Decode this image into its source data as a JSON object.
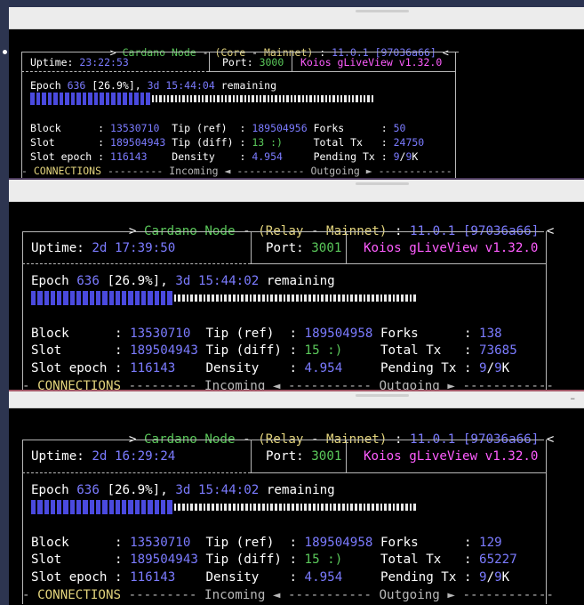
{
  "windows": [
    {
      "id": "core",
      "header": {
        "prefix": ">",
        "app": "Cardano Node",
        "dash1": "-",
        "role_open": "(Core",
        "dash2": "-",
        "network_close": "Mainnet)",
        "colon": ":",
        "version": "11.0.1",
        "commit": "[97036a66]",
        "suffix": "<"
      },
      "uptime_label": "Uptime:",
      "uptime_value": "23:22:53",
      "port_label": "Port:",
      "port_value": "3000",
      "brand": "Koios gLiveView v1.32.0",
      "epoch_label": "Epoch",
      "epoch_number": "636",
      "epoch_percent": "[26.9%],",
      "epoch_remaining": "3d 15:44:04",
      "remaining_word": "remaining",
      "progress": 0.269,
      "block_label": "Block",
      "block_value": "13530710",
      "slot_label": "Slot",
      "slot_value": "189504943",
      "slot_epoch_label": "Slot epoch",
      "slot_epoch_value": "116143",
      "tip_ref_label": "Tip (ref)",
      "tip_ref_value": "189504956",
      "tip_diff_label": "Tip (diff)",
      "tip_diff_value": "13 :)",
      "density_label": "Density",
      "density_value": "4.954",
      "forks_label": "Forks",
      "forks_value": "50",
      "total_tx_label": "Total Tx",
      "total_tx_value": "24750",
      "pending_tx_label": "Pending Tx",
      "pending_tx_a": "9",
      "pending_tx_sep": "/",
      "pending_tx_b": "9",
      "pending_tx_unit": "K",
      "connections_label": "CONNECTIONS",
      "incoming_label": "Incoming ◄",
      "outgoing_label": "Outgoing ►"
    },
    {
      "id": "relay1",
      "header": {
        "prefix": ">",
        "app": "Cardano Node",
        "dash1": "-",
        "role_open": "(Relay",
        "dash2": "-",
        "network_close": "Mainnet)",
        "colon": ":",
        "version": "11.0.1",
        "commit": "[97036a66]",
        "suffix": "<"
      },
      "uptime_label": "Uptime:",
      "uptime_value": "2d 17:39:50",
      "port_label": "Port:",
      "port_value": "3001",
      "brand": "Koios gLiveView v1.32.0",
      "epoch_label": "Epoch",
      "epoch_number": "636",
      "epoch_percent": "[26.9%],",
      "epoch_remaining": "3d 15:44:02",
      "remaining_word": "remaining",
      "progress": 0.269,
      "block_label": "Block",
      "block_value": "13530710",
      "slot_label": "Slot",
      "slot_value": "189504943",
      "slot_epoch_label": "Slot epoch",
      "slot_epoch_value": "116143",
      "tip_ref_label": "Tip (ref)",
      "tip_ref_value": "189504958",
      "tip_diff_label": "Tip (diff)",
      "tip_diff_value": "15 :)",
      "density_label": "Density",
      "density_value": "4.954",
      "forks_label": "Forks",
      "forks_value": "138",
      "total_tx_label": "Total Tx",
      "total_tx_value": "73685",
      "pending_tx_label": "Pending Tx",
      "pending_tx_a": "9",
      "pending_tx_sep": "/",
      "pending_tx_b": "9",
      "pending_tx_unit": "K",
      "connections_label": "CONNECTIONS",
      "incoming_label": "Incoming ◄",
      "outgoing_label": "Outgoing ►"
    },
    {
      "id": "relay2",
      "header": {
        "prefix": ">",
        "app": "Cardano Node",
        "dash1": "-",
        "role_open": "(Relay",
        "dash2": "-",
        "network_close": "Mainnet)",
        "colon": ":",
        "version": "11.0.1",
        "commit": "[97036a66]",
        "suffix": "<"
      },
      "uptime_label": "Uptime:",
      "uptime_value": "2d 16:29:24",
      "port_label": "Port:",
      "port_value": "3001",
      "brand": "Koios gLiveView v1.32.0",
      "epoch_label": "Epoch",
      "epoch_number": "636",
      "epoch_percent": "[26.9%],",
      "epoch_remaining": "3d 15:44:02",
      "remaining_word": "remaining",
      "progress": 0.269,
      "block_label": "Block",
      "block_value": "13530710",
      "slot_label": "Slot",
      "slot_value": "189504943",
      "slot_epoch_label": "Slot epoch",
      "slot_epoch_value": "116143",
      "tip_ref_label": "Tip (ref)",
      "tip_ref_value": "189504958",
      "tip_diff_label": "Tip (diff)",
      "tip_diff_value": "15 :)",
      "density_label": "Density",
      "density_value": "4.954",
      "forks_label": "Forks",
      "forks_value": "129",
      "total_tx_label": "Total Tx",
      "total_tx_value": "65227",
      "pending_tx_label": "Pending Tx",
      "pending_tx_a": "9",
      "pending_tx_sep": "/",
      "pending_tx_b": "9",
      "pending_tx_unit": "K",
      "connections_label": "CONNECTIONS",
      "incoming_label": "Incoming ◄",
      "outgoing_label": "Outgoing ►"
    }
  ],
  "bottom_window_control": "–",
  "colors": {
    "green": "#5ac85a",
    "blue": "#7b7bff",
    "yellow": "#e2d37c",
    "magenta": "#ff5dff",
    "progress_filled": "#4a4adf"
  }
}
